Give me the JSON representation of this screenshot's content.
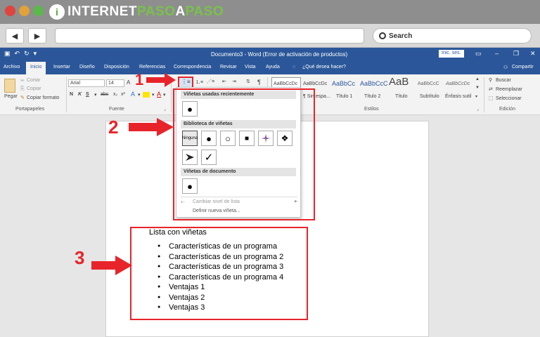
{
  "site": {
    "logo_letter": "i",
    "logo_text_a": "INTERNET",
    "logo_text_b": "PASO",
    "logo_text_c": "A",
    "logo_text_d": "PASO"
  },
  "browser": {
    "back_icon": "back-arrow-icon",
    "forward_icon": "forward-arrow-icon",
    "search_label": "Search"
  },
  "word": {
    "doc_title": "Documento3 - Word (Error de activación de productos)",
    "signin_label": "Inic. ses.",
    "tabs": [
      "Archivo",
      "Inicio",
      "Insertar",
      "Diseño",
      "Disposición",
      "Referencias",
      "Correspondencia",
      "Revisar",
      "Vista",
      "Ayuda"
    ],
    "tell_me": "¿Qué desea hacer?",
    "share": "Compartir",
    "clipboard": {
      "paste": "Pegar",
      "cut": "Cortar",
      "copy": "Copiar",
      "format_painter": "Copiar formato",
      "group": "Portapapeles"
    },
    "font": {
      "name": "Arial",
      "size": "14",
      "group": "Fuente",
      "bold": "N",
      "italic": "K",
      "underline": "S"
    },
    "styles": {
      "group": "Estilos",
      "items": [
        {
          "sample": "AaBbCcDc",
          "name": "¶ Sin espa..."
        },
        {
          "sample": "AaBbCc",
          "name": "Título 1"
        },
        {
          "sample": "AaBbCcC",
          "name": "Título 2"
        },
        {
          "sample": "AaB",
          "name": "Título"
        },
        {
          "sample": "AaBbCcC",
          "name": "Subtítulo"
        },
        {
          "sample": "AaBbCcDc",
          "name": "Énfasis sutil"
        }
      ]
    },
    "editing": {
      "group": "Edición",
      "find": "Buscar",
      "replace": "Reemplazar",
      "select": "Seleccionar"
    }
  },
  "bullet_menu": {
    "recent_header": "Viñetas usadas recientemente",
    "library_header": "Biblioteca de viñetas",
    "document_header": "Viñetas de documento",
    "none_label": "Ninguna",
    "change_level": "Cambiar nivel de lista",
    "define_new": "Definir nueva viñeta..."
  },
  "annotations": {
    "one": "1",
    "two": "2",
    "three": "3"
  },
  "document": {
    "list_title": "Lista con viñetas",
    "items": [
      "Características de un programa",
      "Características de un programa 2",
      "Características de un programa 3",
      "Características de un programa 4",
      "Ventajas 1",
      "Ventajas 2",
      "Ventajas 3"
    ]
  },
  "colors": {
    "word_blue": "#2b579a",
    "annotation_red": "#e8242b",
    "logo_green": "#79c24a"
  }
}
